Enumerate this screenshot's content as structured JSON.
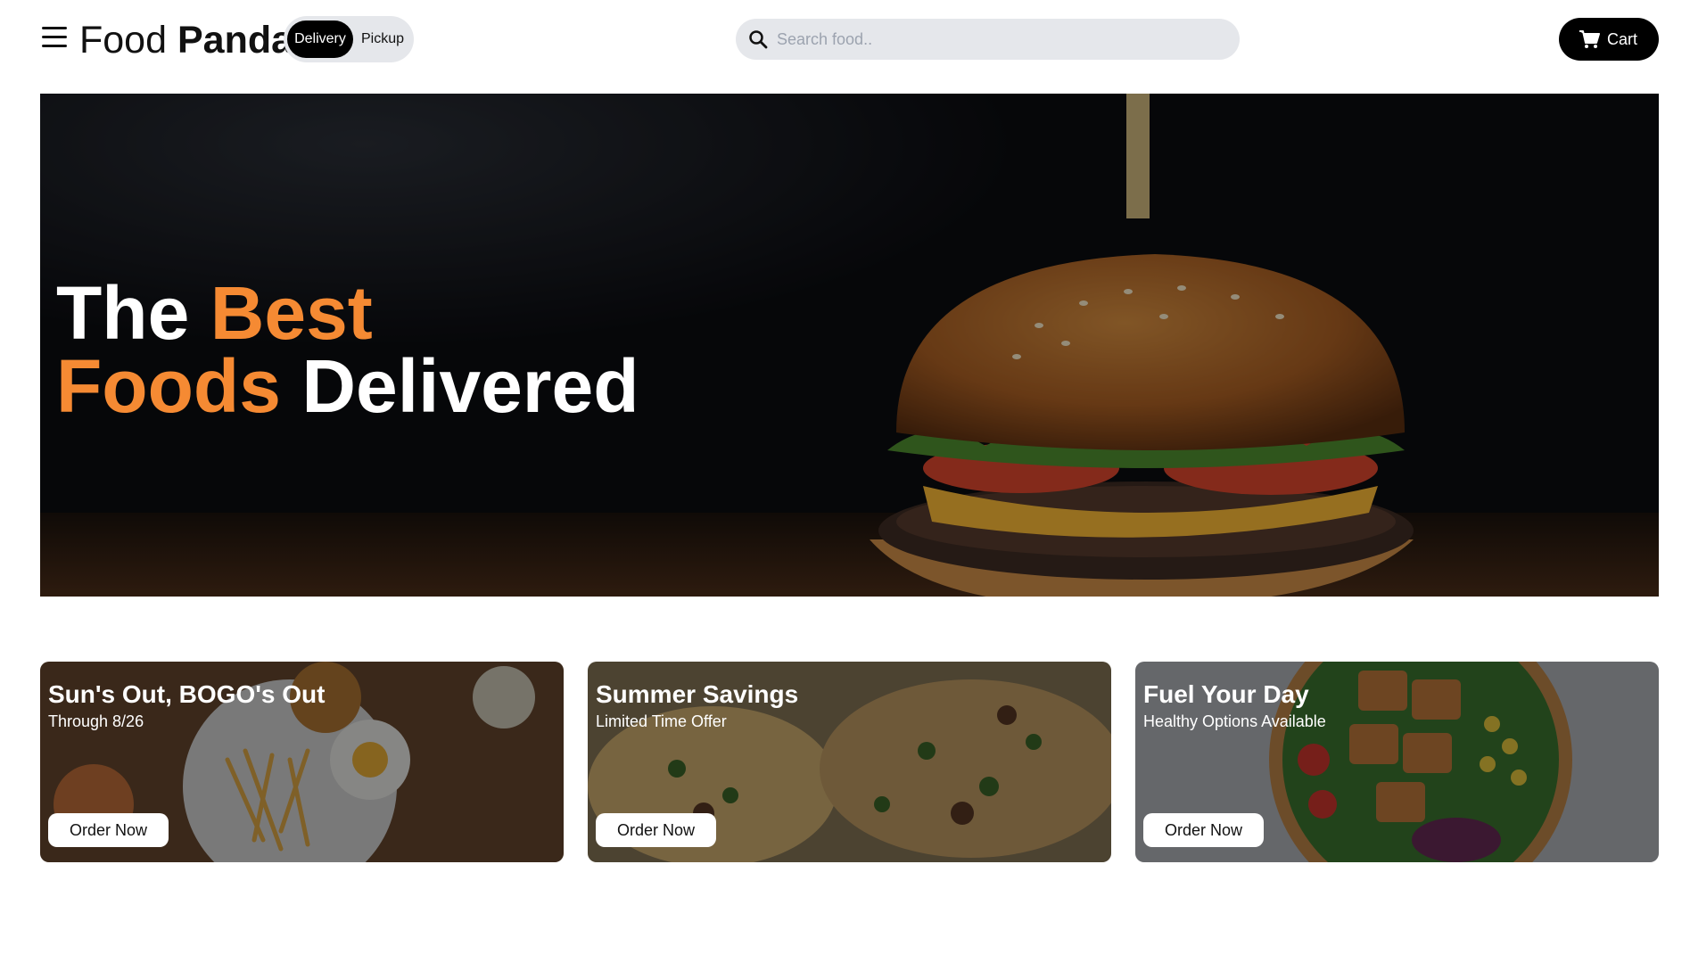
{
  "header": {
    "brand_light": "Food",
    "brand_bold": "Panda",
    "modes": {
      "delivery": "Delivery",
      "pickup": "Pickup",
      "selected": "Delivery"
    },
    "search_placeholder": "Search food..",
    "cart_label": "Cart",
    "icons": [
      "menu-icon",
      "search-icon",
      "cart-icon"
    ]
  },
  "hero": {
    "word1": "The",
    "word2": "Best",
    "word3": "Foods",
    "word4": "Delivered",
    "accent_color": "#f58a33"
  },
  "cards": [
    {
      "title": "Sun's Out, BOGO's Out",
      "subtitle": "Through 8/26",
      "button": "Order Now"
    },
    {
      "title": "Summer Savings",
      "subtitle": "Limited Time Offer",
      "button": "Order Now"
    },
    {
      "title": "Fuel Your Day",
      "subtitle": "Healthy Options Available",
      "button": "Order Now"
    }
  ]
}
